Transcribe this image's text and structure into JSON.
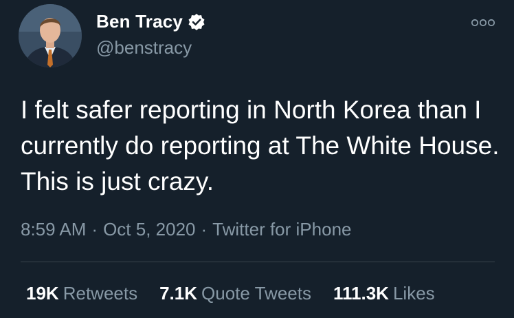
{
  "author": {
    "display_name": "Ben Tracy",
    "handle": "@benstracy",
    "verified": true,
    "avatar_icon": "profile-photo"
  },
  "tweet": {
    "text": "I felt safer reporting in North Korea than I currently do reporting at The White House. This is just crazy.",
    "time": "8:59 AM",
    "date": "Oct 5, 2020",
    "source": "Twitter for iPhone",
    "separator": "·"
  },
  "stats": {
    "retweets_count": "19K",
    "retweets_label": "Retweets",
    "quotes_count": "7.1K",
    "quotes_label": "Quote Tweets",
    "likes_count": "111.3K",
    "likes_label": "Likes"
  },
  "colors": {
    "background": "#15202b",
    "secondary_text": "#8899a6",
    "divider": "#38444d"
  }
}
